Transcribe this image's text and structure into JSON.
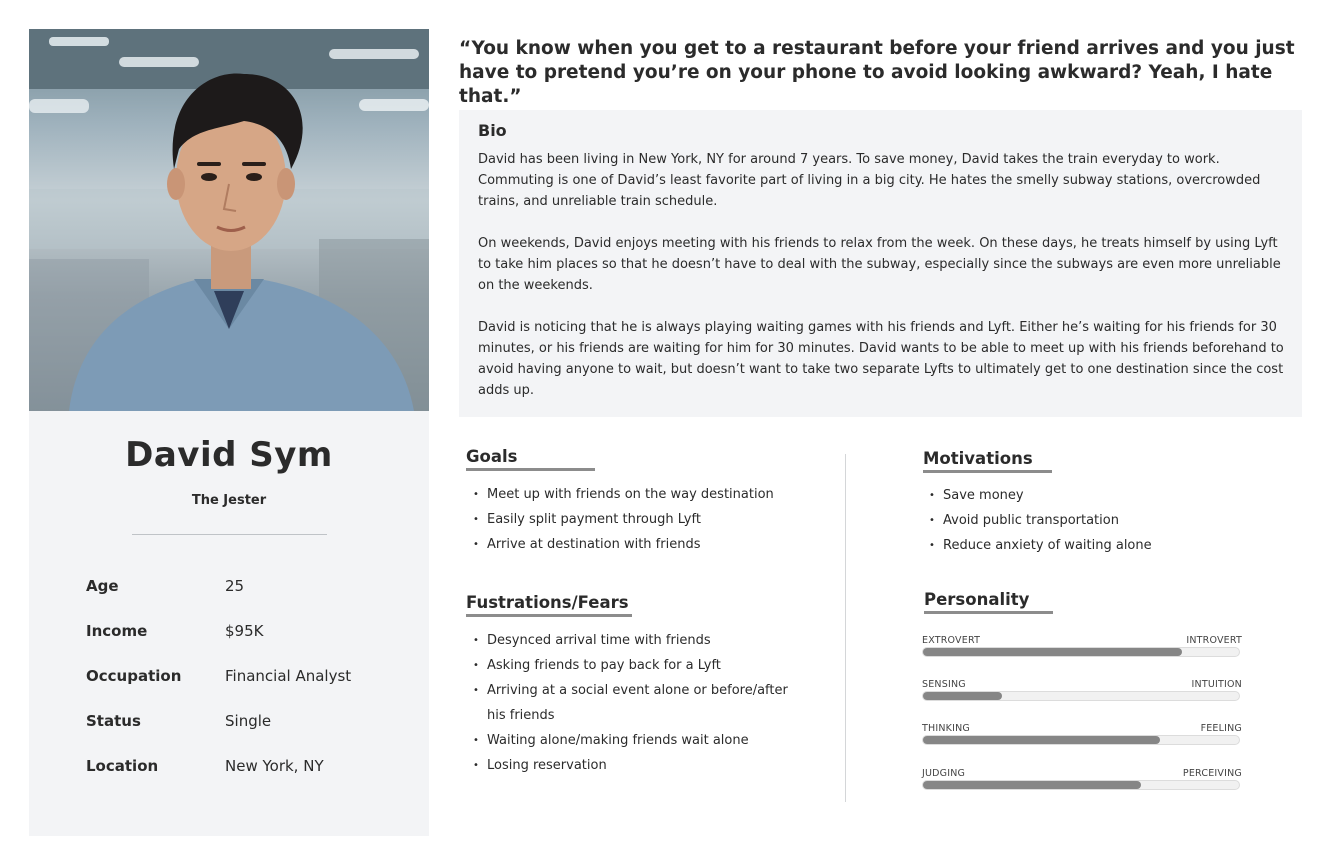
{
  "persona": {
    "name": "David Sym",
    "role": "The Jester",
    "facts": [
      {
        "label": "Age",
        "value": "25"
      },
      {
        "label": "Income",
        "value": "$95K"
      },
      {
        "label": "Occupation",
        "value": "Financial Analyst"
      },
      {
        "label": "Status",
        "value": "Single"
      },
      {
        "label": "Location",
        "value": "New York, NY"
      }
    ]
  },
  "quote": "“You know when you get to a restaurant before your friend arrives and you just have to pretend you’re on your phone to avoid looking awkward? Yeah, I hate that.”",
  "bio": {
    "title": "Bio",
    "paragraphs": [
      "David has been living in New York, NY for around 7 years. To save money, David takes the train everyday to work. Commuting is one of David’s least favorite part of living in a big city. He hates the smelly subway stations, overcrowded trains, and unreliable train schedule.",
      "On weekends, David enjoys meeting with his friends to relax from the week. On these days, he treats himself by using Lyft to take him places so that he doesn’t have to deal with the subway, especially since the subways are even more unreliable on the weekends.",
      "David is noticing that he is always playing waiting games with his friends and Lyft. Either he’s waiting for his friends for 30 minutes, or his friends are waiting for him for 30 minutes. David wants to be able to meet up with his friends beforehand to avoid having anyone to wait, but doesn’t want to take two separate Lyfts to ultimately get to one destination since the cost adds up."
    ]
  },
  "goals": {
    "title": "Goals",
    "items": [
      "Meet up with friends on the way destination",
      "Easily split payment through Lyft",
      "Arrive at destination with friends"
    ]
  },
  "frustrations": {
    "title": "Fustrations/Fears",
    "items": [
      "Desynced arrival time with friends",
      "Asking friends to pay back for a Lyft",
      "Arriving at a social event alone or before/after his friends",
      "Waiting alone/making friends wait alone",
      "Losing reservation"
    ]
  },
  "motivations": {
    "title": "Motivations",
    "items": [
      "Save money",
      "Avoid public transportation",
      "Reduce anxiety of waiting alone"
    ]
  },
  "personality": {
    "title": "Personality",
    "traits": [
      {
        "left": "EXTROVERT",
        "right": "INTROVERT",
        "value": 0.82
      },
      {
        "left": "SENSING",
        "right": "INTUITION",
        "value": 0.25
      },
      {
        "left": "THINKING",
        "right": "FEELING",
        "value": 0.75
      },
      {
        "left": "JUDGING",
        "right": "PERCEIVING",
        "value": 0.69
      }
    ],
    "fill_color": "#868686"
  }
}
